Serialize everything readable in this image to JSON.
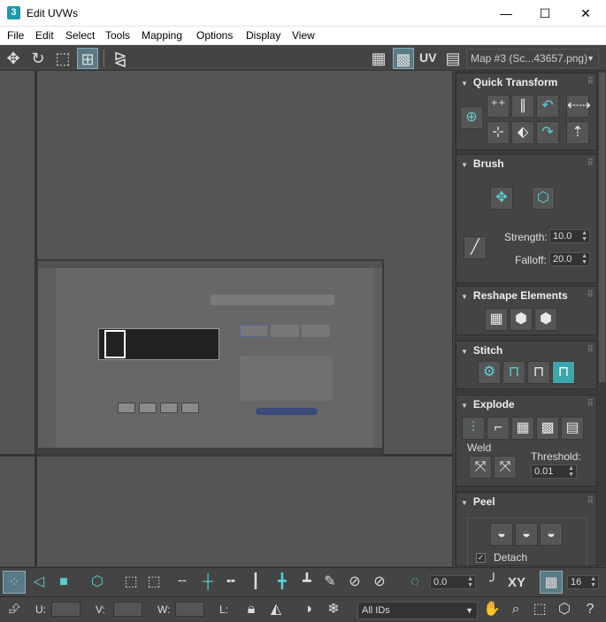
{
  "window": {
    "app_icon": "3",
    "title": "Edit UVWs",
    "minimize": "—",
    "maximize": "☐",
    "close": "✕"
  },
  "menu": [
    "File",
    "Edit",
    "Select",
    "Tools",
    "Mapping",
    "Options",
    "Display",
    "View"
  ],
  "toolbar": {
    "uv_label": "UV",
    "map_dropdown": "Map #3 (Sc...43657.png)"
  },
  "panel": {
    "quick_transform": {
      "title": "Quick Transform"
    },
    "brush": {
      "title": "Brush",
      "strength_label": "Strength:",
      "strength_value": "10.0",
      "falloff_label": "Falloff:",
      "falloff_value": "20.0"
    },
    "reshape": {
      "title": "Reshape Elements"
    },
    "stitch": {
      "title": "Stitch"
    },
    "explode": {
      "title": "Explode",
      "weld_label": "Weld",
      "threshold_label": "Threshold:",
      "threshold_value": "0.01"
    },
    "peel": {
      "title": "Peel",
      "detach_label": "Detach",
      "detach_checked": true
    }
  },
  "bottom": {
    "angle_value": "0.0",
    "xy_label": "XY",
    "grid_value": "16",
    "u_label": "U:",
    "v_label": "V:",
    "w_label": "W:",
    "l_label": "L:",
    "ids_dropdown": "All IDs"
  },
  "colors": {
    "accent": "#5ccfd6",
    "panel_bg": "#444444",
    "viewport_bg": "#555555"
  }
}
